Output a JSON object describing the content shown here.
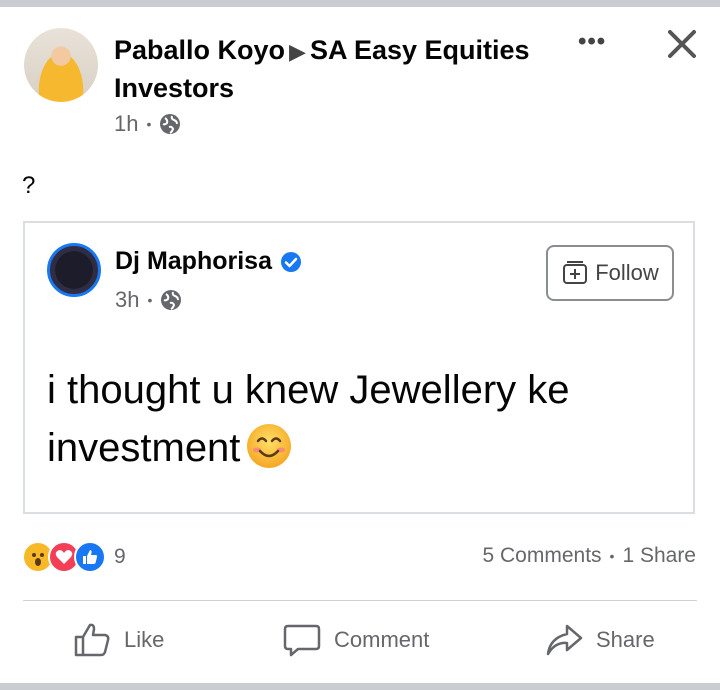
{
  "post": {
    "author": "Paballo Koyo",
    "group": "SA Easy Equities Investors",
    "time": "1h",
    "text": "?"
  },
  "shared_post": {
    "author": "Dj Maphorisa",
    "time": "3h",
    "follow_label": "Follow",
    "body": "i thought u knew Jewellery ke investment"
  },
  "engagement": {
    "reaction_count": "9",
    "comments": "5 Comments",
    "shares": "1 Share"
  },
  "actions": {
    "like": "Like",
    "comment": "Comment",
    "share": "Share"
  },
  "colors": {
    "accent": "#1877f2",
    "secondary_text": "#65676b",
    "primary_text": "#050505"
  },
  "icons": {
    "more": "more-options-icon",
    "close": "close-icon",
    "privacy": "globe-icon",
    "verified": "verified-badge-icon",
    "follow": "follow-icon",
    "reactions": [
      "wow-reaction-icon",
      "love-reaction-icon",
      "like-reaction-icon"
    ],
    "emoji": "smiling-face-emoji"
  }
}
